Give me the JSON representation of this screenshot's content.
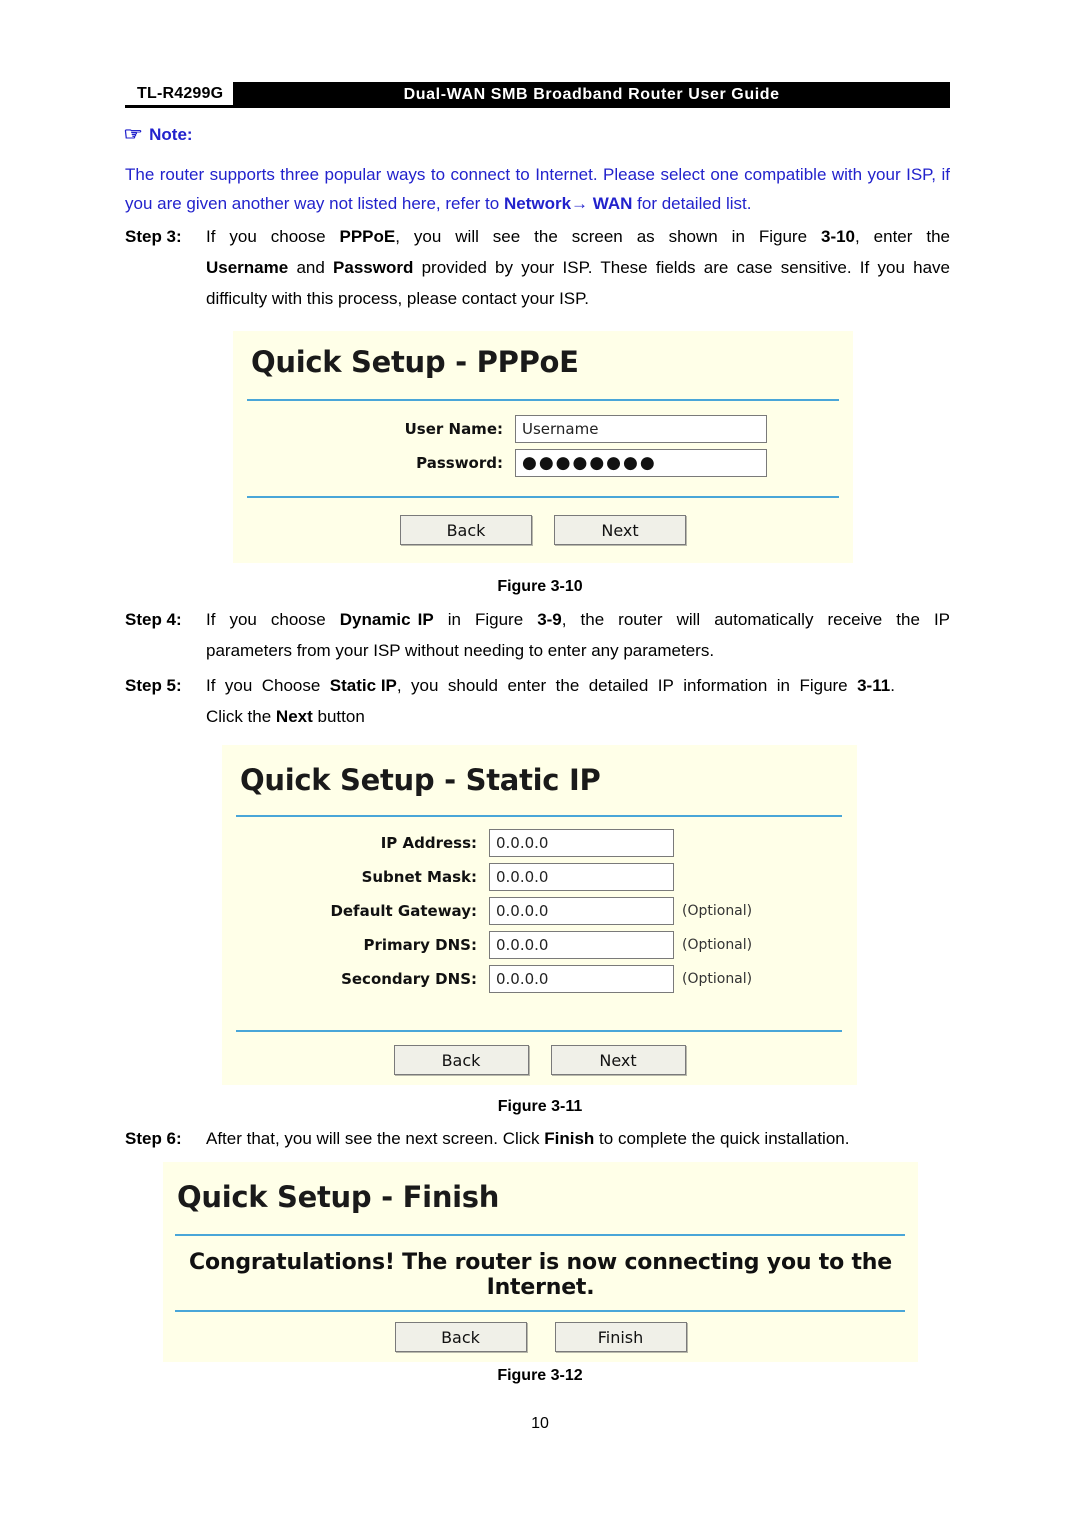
{
  "header": {
    "model": "TL-R4299G",
    "title": "Dual-WAN SMB Broadband Router User Guide"
  },
  "note": {
    "label": "Note:",
    "icon": "pointing-hand-icon",
    "text_part1": "The router supports three popular ways to connect to Internet. Please select one compatible with your ISP, if you are given another way not listed here, refer to ",
    "link": "Network→ WAN",
    "text_part2": " for detailed list."
  },
  "steps": {
    "step3": {
      "label": "Step 3:",
      "text": "If you choose PPPoE, you will see the screen as shown in Figure 3-10, enter the Username and Password provided by your ISP. These fields are case sensitive. If you have difficulty with this process, please contact your ISP."
    },
    "step4": {
      "label": "Step 4:",
      "text": "If you choose Dynamic IP in Figure 3-9, the router will automatically receive the IP parameters from your ISP without needing to enter any parameters."
    },
    "step5": {
      "label": "Step 5:",
      "text": "If you Choose Static IP, you should enter the detailed IP information in Figure 3-11. Click the Next button"
    },
    "step6": {
      "label": "Step 6:",
      "text": "After that, you will see the next screen. Click Finish to complete the quick installation."
    }
  },
  "figure_pppoe": {
    "title": "Quick Setup - PPPoE",
    "fields": [
      {
        "label": "User Name:",
        "value": "Username"
      },
      {
        "label": "Password:",
        "value": "●●●●●●●●"
      }
    ],
    "buttons": {
      "back": "Back",
      "next": "Next"
    },
    "caption": "Figure 3-10"
  },
  "figure_static": {
    "title": "Quick Setup - Static IP",
    "fields": [
      {
        "label": "IP Address:",
        "value": "0.0.0.0",
        "hint": ""
      },
      {
        "label": "Subnet Mask:",
        "value": "0.0.0.0",
        "hint": ""
      },
      {
        "label": "Default Gateway:",
        "value": "0.0.0.0",
        "hint": "(Optional)"
      },
      {
        "label": "Primary DNS:",
        "value": "0.0.0.0",
        "hint": "(Optional)"
      },
      {
        "label": "Secondary DNS:",
        "value": "0.0.0.0",
        "hint": "(Optional)"
      }
    ],
    "buttons": {
      "back": "Back",
      "next": "Next"
    },
    "caption": "Figure 3-11"
  },
  "figure_finish": {
    "title": "Quick Setup - Finish",
    "message": "Congratulations! The router is now connecting you to the Internet.",
    "buttons": {
      "back": "Back",
      "finish": "Finish"
    },
    "caption": "Figure 3-12"
  },
  "page_number": "10",
  "colors": {
    "note_blue": "#2222cc",
    "panel_bg": "#ffffe8",
    "rule_blue": "#4aa6d8",
    "header_bar": "#000000"
  }
}
